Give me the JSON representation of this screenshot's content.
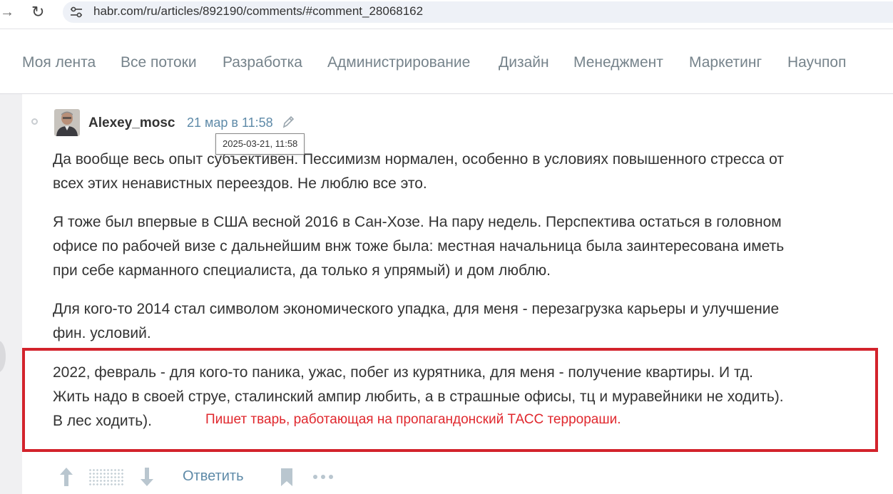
{
  "browser": {
    "url": "habr.com/ru/articles/892190/comments/#comment_28068162"
  },
  "nav": {
    "items": [
      "Моя лента",
      "Все потоки",
      "Разработка",
      "Администрирование",
      "Дизайн",
      "Менеджмент",
      "Маркетинг",
      "Научпоп"
    ]
  },
  "comment": {
    "author": "Alexey_mosc",
    "time": "21 мар в 11:58",
    "tooltip": "2025-03-21, 11:58",
    "paragraphs": [
      [
        "Да вообще весь опыт субъективен. Пессимизм нормален, особенно в условиях повышенного стресса от",
        "всех этих ненавистных переездов. Не люблю все это."
      ],
      [
        "Я тоже был впервые в США весной 2016 в Сан-Хозе. На пару недель. Перспектива остаться в головном",
        "офисе по рабочей визе с дальнейшим внж тоже была: местная начальница была заинтересована иметь",
        "при себе карманного специалиста, да только я упрямый) и дом люблю."
      ],
      [
        "Для кого-то 2014 стал символом экономического упадка, для меня - перезагрузка карьеры и улучшение",
        "фин. условий."
      ],
      [
        "2022, февраль - для кого-то паника, ужас, побег из курятника, для меня - получение квартиры. И тд.",
        "Жить надо в своей струе, сталинский ампир любить, а в страшные офисы, тц и муравейники не ходить).",
        "В лес ходить)."
      ]
    ],
    "annotation": "Пишет тварь, работающая на пропагандонский ТАСС террораши.",
    "reply_label": "Ответить"
  },
  "colors": {
    "link": "#5e8aa8",
    "annotation_red": "#e0282e",
    "frame_red": "#d3232c",
    "nav_text": "#76838b"
  },
  "icons": [
    "back-arrow-icon",
    "reload-icon",
    "site-settings-icon",
    "edit-pencil-icon",
    "upvote-arrow-icon",
    "downvote-arrow-icon",
    "bookmark-icon",
    "more-dots-icon"
  ]
}
